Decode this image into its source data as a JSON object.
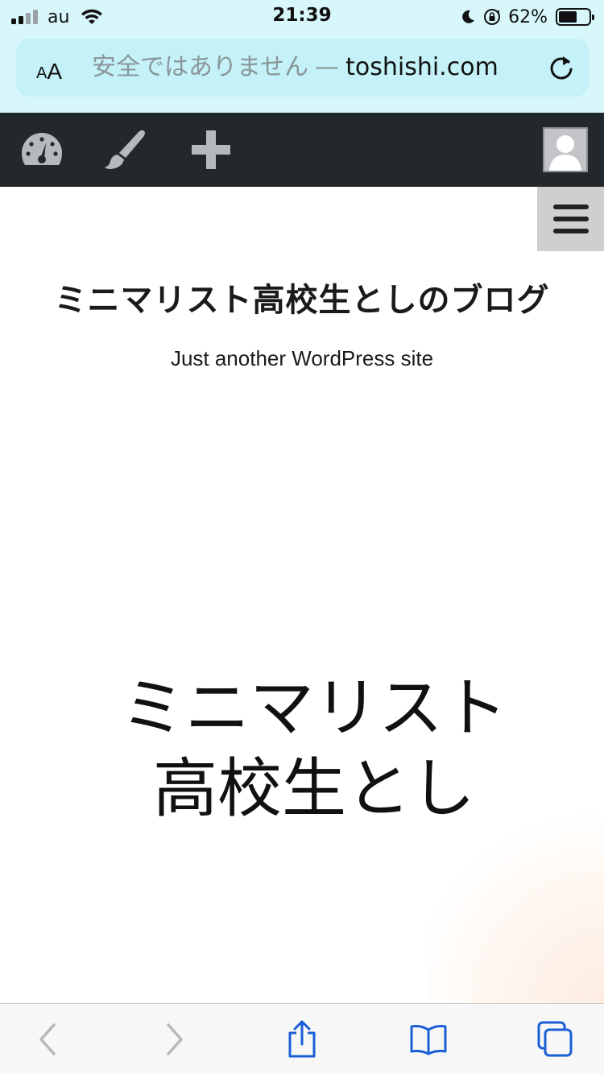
{
  "status_bar": {
    "carrier": "au",
    "time": "21:39",
    "battery_percent_text": "62%",
    "battery_level": 0.62,
    "signal_bars_active": 2,
    "signal_bars_total": 4
  },
  "browser": {
    "text_size_button_small": "A",
    "text_size_button_big": "A",
    "security_warning": "安全ではありません",
    "separator": "—",
    "domain": "toshishi.com"
  },
  "admin_bar": {
    "items": [
      "dashboard-icon",
      "customize-brush-icon",
      "add-new-icon",
      "avatar"
    ]
  },
  "site": {
    "title": "ミニマリスト高校生としのブログ",
    "tagline": "Just another WordPress site"
  },
  "header_image": {
    "line1": "ミニマリスト",
    "line2": "高校生とし"
  },
  "toolbar": {
    "items": [
      "back-icon",
      "forward-icon",
      "share-icon",
      "bookmarks-icon",
      "tabs-icon"
    ]
  },
  "colors": {
    "chrome_bg": "#d7f7fb",
    "url_bar_bg": "#c4f2f8",
    "admin_bar_bg": "#23282d",
    "ios_blue": "#1a5fd6"
  }
}
